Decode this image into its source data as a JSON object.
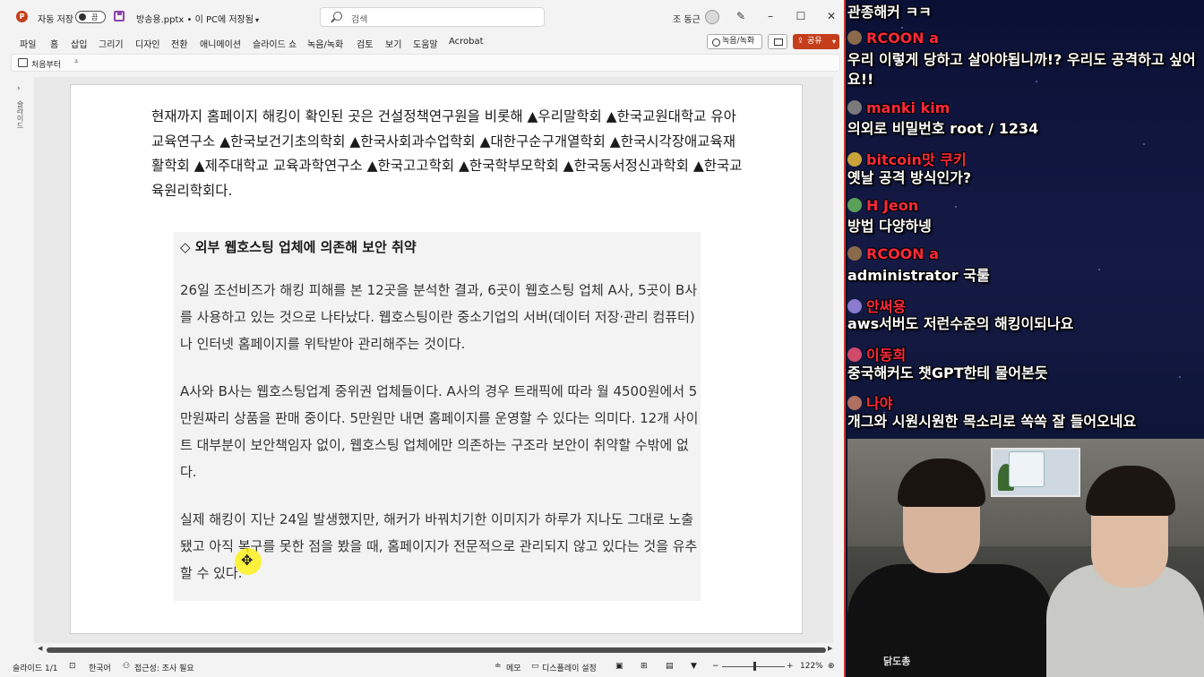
{
  "titlebar": {
    "app_logo": "P",
    "autosave_label": "자동 저장",
    "autosave_state": "끔",
    "doc_title": "방송용.pptx • 이 PC에 저장됨",
    "search_placeholder": "검색",
    "user_name": "조 동근",
    "minimize": "–",
    "maximize": "☐",
    "close": "✕"
  },
  "menu": [
    "파일",
    "홈",
    "삽입",
    "그리기",
    "디자인",
    "전환",
    "애니메이션",
    "슬라이드 쇼",
    "녹음/녹화",
    "검토",
    "보기",
    "도움말",
    "Acrobat"
  ],
  "menu_right": {
    "record": "녹음/녹화",
    "share": "공유"
  },
  "ribbon": {
    "from_start": "처음부터"
  },
  "leftrail": {
    "label": "슬라이드"
  },
  "slide": {
    "intro": "현재까지 홈페이지 해킹이 확인된 곳은 건설정책연구원을 비롯해 ▲우리말학회 ▲한국교원대학교 유아교육연구소 ▲한국보건기초의학회 ▲한국사회과수업학회 ▲대한구순구개열학회 ▲한국시각장애교육재활학회 ▲제주대학교 교육과학연구소 ▲한국고고학회 ▲한국학부모학회 ▲한국동서정신과학회 ▲한국교육원리학회다.",
    "card_heading": "◇ 외부 웹호스팅 업체에 의존해 보안 취약",
    "paragraphs": [
      "26일 조선비즈가 해킹 피해를 본 12곳을 분석한 결과, 6곳이 웹호스팅 업체 A사, 5곳이 B사를 사용하고 있는 것으로 나타났다. 웹호스팅이란 중소기업의 서버(데이터 저장·관리 컴퓨터)나 인터넷 홈페이지를 위탁받아 관리해주는 것이다.",
      "A사와 B사는 웹호스팅업계 중위권 업체들이다. A사의 경우 트래픽에 따라 월 4500원에서 5만원짜리 상품을 판매 중이다. 5만원만 내면 홈페이지를 운영할 수 있다는 의미다. 12개 사이트 대부분이 보안책임자 없이, 웹호스팅 업체에만 의존하는 구조라 보안이 취약할 수밖에 없다.",
      "실제 해킹이 지난 24일 발생했지만, 해커가 바꿔치기한 이미지가 하루가 지나도 그대로 노출됐고 아직 복구를 못한 점을 봤을 때, 홈페이지가 전문적으로 관리되지 않고 있다는 것을 유추할 수 있다."
    ]
  },
  "statusbar": {
    "slide_num": "슬라이드 1/1",
    "language": "한국어",
    "accessibility": "접근성: 조사 필요",
    "notes": "메모",
    "display_settings": "디스플레이 설정",
    "zoom": "122%"
  },
  "chat": [
    {
      "user": "",
      "message": "관종해커 ㅋㅋ",
      "color": "#ff2a3a"
    },
    {
      "user": "RCOON a",
      "message": "우리 이렇게 당하고 살아야됩니까!? 우리도 공격하고 싶어요!!",
      "color": "#ff2a3a"
    },
    {
      "user": "manki kim",
      "message": "의외로 비밀번호 root / 1234",
      "color": "#ff2a3a"
    },
    {
      "user": "bitcoin맛 쿠키",
      "message": "옛날 공격 방식인가?",
      "color": "#ff2a3a"
    },
    {
      "user": "H Jeon",
      "message": "방법 다양하넹",
      "color": "#ff2a3a"
    },
    {
      "user": "RCOON a",
      "message": "administrator 국룰",
      "color": "#ff2a3a"
    },
    {
      "user": "안써용",
      "message": "aws서버도 저런수준의 해킹이되나요",
      "color": "#ff2a3a"
    },
    {
      "user": "이동희",
      "message": "중국해커도 챗GPT한테 물어본듯",
      "color": "#ff2a3a"
    },
    {
      "user": "나야",
      "message": "개그와 시원시원한 목소리로 쏙쏙 잘 들어오네요",
      "color": "#ff2a3a"
    }
  ],
  "webcam": {
    "shirt_text": "닭도총"
  }
}
